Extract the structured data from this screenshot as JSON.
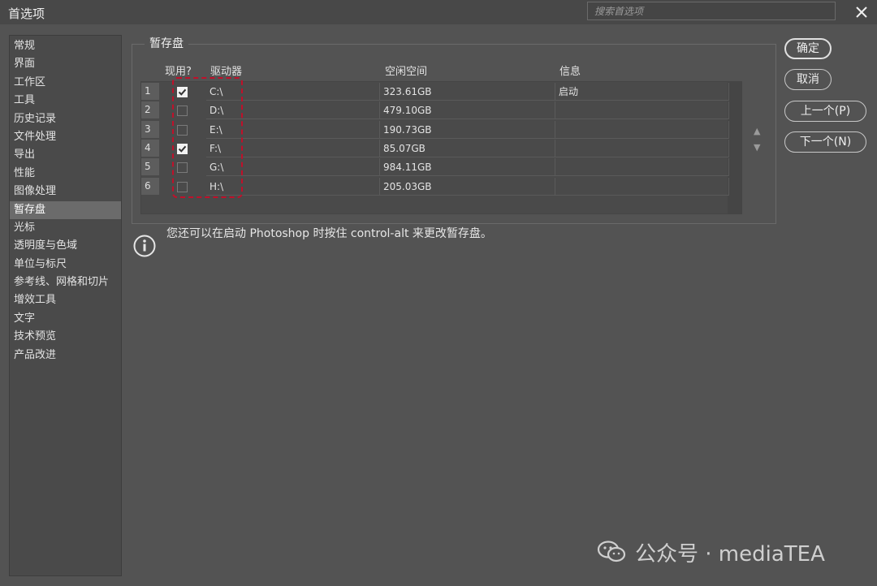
{
  "window": {
    "title": "首选项"
  },
  "search": {
    "placeholder": "搜索首选项"
  },
  "sidebar": {
    "items": [
      {
        "label": "常规"
      },
      {
        "label": "界面"
      },
      {
        "label": "工作区"
      },
      {
        "label": "工具"
      },
      {
        "label": "历史记录"
      },
      {
        "label": "文件处理"
      },
      {
        "label": "导出"
      },
      {
        "label": "性能"
      },
      {
        "label": "图像处理"
      },
      {
        "label": "暂存盘"
      },
      {
        "label": "光标"
      },
      {
        "label": "透明度与色域"
      },
      {
        "label": "单位与标尺"
      },
      {
        "label": "参考线、网格和切片"
      },
      {
        "label": "增效工具"
      },
      {
        "label": "文字"
      },
      {
        "label": "技术预览"
      },
      {
        "label": "产品改进"
      }
    ],
    "active_index": 9
  },
  "panel": {
    "title": "暂存盘"
  },
  "table": {
    "headers": {
      "active": "现用?",
      "drive": "驱动器",
      "free": "空闲空间",
      "info": "信息"
    },
    "rows": [
      {
        "num": "1",
        "checked": true,
        "drive": "C:\\",
        "free": "323.61GB",
        "info": "启动"
      },
      {
        "num": "2",
        "checked": false,
        "drive": "D:\\",
        "free": "479.10GB",
        "info": ""
      },
      {
        "num": "3",
        "checked": false,
        "drive": "E:\\",
        "free": "190.73GB",
        "info": ""
      },
      {
        "num": "4",
        "checked": true,
        "drive": "F:\\",
        "free": "85.07GB",
        "info": ""
      },
      {
        "num": "5",
        "checked": false,
        "drive": "G:\\",
        "free": "984.11GB",
        "info": ""
      },
      {
        "num": "6",
        "checked": false,
        "drive": "H:\\",
        "free": "205.03GB",
        "info": ""
      }
    ]
  },
  "info_text": "您还可以在启动 Photoshop 时按住 control-alt 来更改暂存盘。",
  "buttons": {
    "ok": "确定",
    "cancel": "取消",
    "prev": "上一个(P)",
    "next": "下一个(N)"
  },
  "arrows": {
    "up": "▲",
    "down": "▼"
  },
  "watermark": "公众号 · mediaTEA",
  "colors": {
    "background": "#535353",
    "highlight": "#c0102a"
  }
}
